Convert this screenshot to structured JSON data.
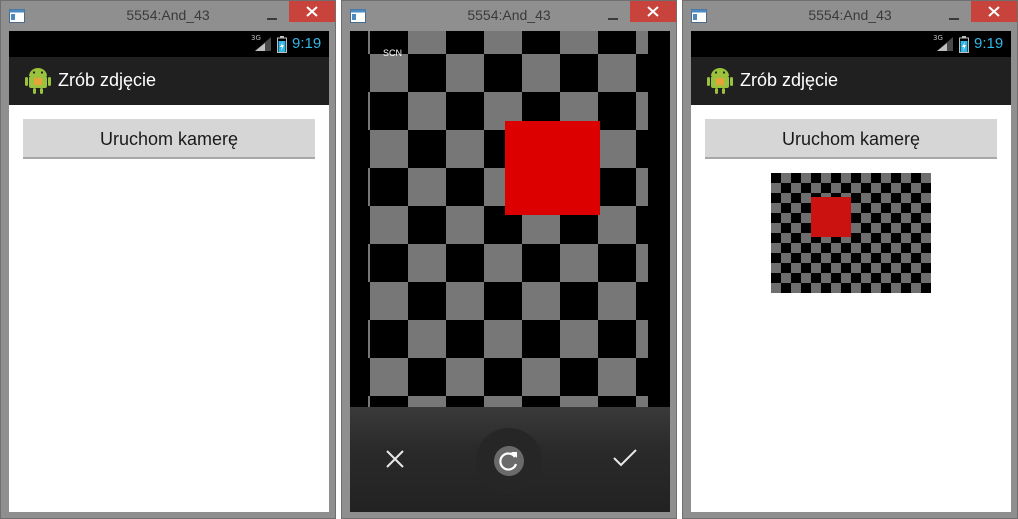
{
  "windows": [
    {
      "title": "5554:And_43",
      "status": {
        "network": "3G",
        "time": "9:19"
      },
      "app_title": "Zrób zdjęcie",
      "button_label": "Uruchom kamerę"
    },
    {
      "title": "5554:And_43",
      "camera": {
        "mode_label": "SCN"
      }
    },
    {
      "title": "5554:And_43",
      "status": {
        "network": "3G",
        "time": "9:19"
      },
      "app_title": "Zrób zdjęcie",
      "button_label": "Uruchom kamerę"
    }
  ],
  "colors": {
    "status_time": "#33b5e5",
    "close_button": "#c7433c",
    "capture_red": "#dd0000"
  },
  "icons": {
    "window": "window-icon",
    "minimize": "minimize-icon",
    "close": "close-icon",
    "signal": "signal-icon",
    "battery": "battery-icon",
    "app": "android-icon",
    "cancel": "cancel-x-icon",
    "retake": "retake-icon",
    "confirm": "checkmark-icon"
  }
}
